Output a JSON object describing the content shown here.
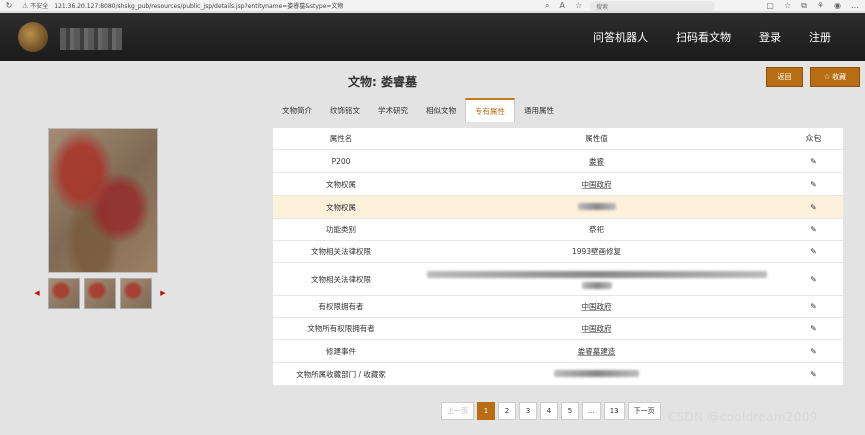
{
  "browser": {
    "security_label": "不安全",
    "url": "121.36.20.127:8080/shskg_pub/resources/public_jsp/details.jsp?entityname=娄睿墓&stype=文物",
    "search_placeholder": "搜索"
  },
  "header": {
    "nav": [
      "问答机器人",
      "扫码看文物",
      "登录",
      "注册"
    ]
  },
  "page": {
    "title": "文物: 娄睿墓",
    "back_label": "返回",
    "fav_label": "收藏"
  },
  "tabs": [
    {
      "label": "文物简介",
      "active": false
    },
    {
      "label": "纹饰铭文",
      "active": false
    },
    {
      "label": "学术研究",
      "active": false
    },
    {
      "label": "相似文物",
      "active": false
    },
    {
      "label": "专有属性",
      "active": true
    },
    {
      "label": "通用属性",
      "active": false
    }
  ],
  "table": {
    "headers": {
      "name": "属性名",
      "value": "属性值",
      "edit": "众包"
    },
    "rows": [
      {
        "name": "P200",
        "value": "娄睿",
        "style": "link"
      },
      {
        "name": "文物权属",
        "value": "中国政府",
        "style": "link"
      },
      {
        "name": "文物权属",
        "value": "",
        "style": "blurred",
        "highlight": true
      },
      {
        "name": "功能类别",
        "value": "祭祀",
        "style": "plain"
      },
      {
        "name": "文物相关法律权限",
        "value": "1993壁画修复",
        "style": "plain"
      },
      {
        "name": "文物相关法律权限",
        "value": "",
        "style": "blurred-long"
      },
      {
        "name": "有权限拥有者",
        "value": "中国政府",
        "style": "link"
      },
      {
        "name": "文物所有权限拥有者",
        "value": "中国政府",
        "style": "link"
      },
      {
        "name": "修建事件",
        "value": "娄睿墓建造",
        "style": "link"
      },
      {
        "name": "文物所属收藏部门 / 收藏家",
        "value": "",
        "style": "blurred"
      }
    ]
  },
  "pagination": {
    "prev": "上一页",
    "pages": [
      "1",
      "2",
      "3",
      "4",
      "5",
      "...",
      "13"
    ],
    "current": "1",
    "next": "下一页"
  },
  "watermark": "CSDN @cooldream2009",
  "colors": {
    "accent": "#b96d12",
    "header_bg": "#1f1f1f",
    "highlight_row": "#fdf1dc"
  }
}
